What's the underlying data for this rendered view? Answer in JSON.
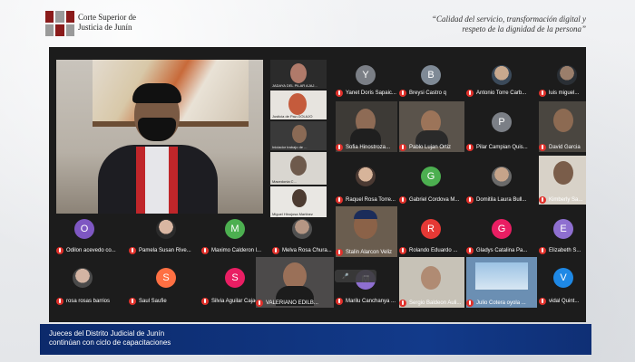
{
  "header": {
    "org_line1": "Corte Superior de",
    "org_line2": "Justicia de Junín",
    "motto_line1": "“Calidad del servicio, transformación digital y",
    "motto_line2": "respeto de la dignidad de la persona”"
  },
  "caption": {
    "line1": "Jueces del Distrito Judicial de Junín",
    "line2": "continúan con ciclo de capacitaciones"
  },
  "colors": {
    "caption_bg": "#123a8a",
    "mic_muted": "#e0312b",
    "brand_red": "#8a1b1b"
  },
  "mini_tiles": [
    {
      "name": "JADAYA DEL PILAR AJAJ..."
    },
    {
      "name": "Justicia de Paz-GOLAJO"
    },
    {
      "name": "Iniciador trabajo de ..."
    },
    {
      "name": "Macedonia C..."
    },
    {
      "name": "Miguel Hinojosa Martinez"
    }
  ],
  "participants": [
    {
      "name": "Yanet Doris Sapaic...",
      "initial": "Y",
      "color": "#7b7f86"
    },
    {
      "name": "Breysi Castro q",
      "initial": "B",
      "color": "#7f8a96"
    },
    {
      "name": "Antonio Torre Carb...",
      "initial": "",
      "color": ""
    },
    {
      "name": "luis miguel...",
      "initial": "",
      "color": ""
    },
    {
      "name": "Sofia Hinostroza...",
      "initial": "",
      "color": ""
    },
    {
      "name": "Pablo Lujan Ortiz",
      "initial": "",
      "color": ""
    },
    {
      "name": "Pilar Campian Quis...",
      "initial": "P",
      "color": "#7b7f86"
    },
    {
      "name": "David Garcia",
      "initial": "",
      "color": ""
    },
    {
      "name": "Raquel Rosa Torre...",
      "initial": "",
      "color": ""
    },
    {
      "name": "Gabriel Cordova M...",
      "initial": "G",
      "color": "#4caf50"
    },
    {
      "name": "Domitila Laura Bull...",
      "initial": "",
      "color": ""
    },
    {
      "name": "Kimberly Sa...",
      "initial": "",
      "color": ""
    },
    {
      "name": "Odilon acevedo co...",
      "initial": "O",
      "color": "#7e57c2"
    },
    {
      "name": "Pamela Susan Rive...",
      "initial": "",
      "color": ""
    },
    {
      "name": "Maximo Calderon l...",
      "initial": "M",
      "color": "#4caf50"
    },
    {
      "name": "Melva Rosa Chura...",
      "initial": "",
      "color": ""
    },
    {
      "name": "Stalin Alarcon Veliz",
      "initial": "",
      "color": ""
    },
    {
      "name": "Rolando Eduardo ...",
      "initial": "R",
      "color": "#e53935"
    },
    {
      "name": "Gladys Catalina Pa...",
      "initial": "G",
      "color": "#e91e63"
    },
    {
      "name": "Elizabeth S...",
      "initial": "E",
      "color": "#8e6fd0"
    },
    {
      "name": "rosa rosas barrios",
      "initial": "",
      "color": ""
    },
    {
      "name": "Saul Saufie",
      "initial": "S",
      "color": "#ff7043"
    },
    {
      "name": "Silvia Aguilar Cajac...",
      "initial": "S",
      "color": "#e91e63"
    },
    {
      "name": "VALERIANO EDILB...",
      "initial": "",
      "color": ""
    },
    {
      "name": "Marilu Canchanya ...",
      "initial": "M",
      "color": "#8e6fd0"
    },
    {
      "name": "Sergio Baldeon Auli...",
      "initial": "",
      "color": ""
    },
    {
      "name": "Julio Cotera oyola ...",
      "initial": "",
      "color": ""
    },
    {
      "name": "vidal Quint...",
      "initial": "V",
      "color": "#1e88e5"
    }
  ]
}
